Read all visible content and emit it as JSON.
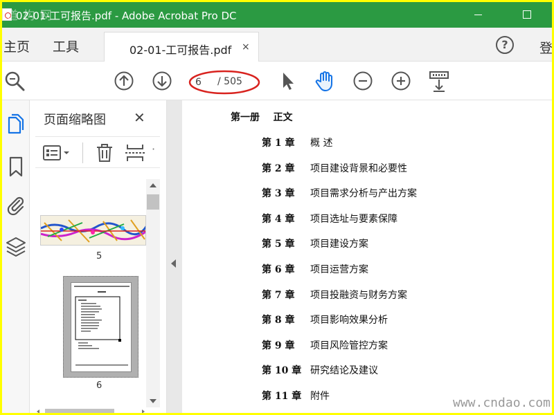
{
  "window": {
    "title": "02-01-工可报告.pdf - Adobe Acrobat Pro DC",
    "watermark_logo": "道·构·网"
  },
  "menubar": {
    "home": "主页",
    "tools": "工具",
    "tab_label": "02-01-工可报告.pdf",
    "tab_close": "×",
    "help": "?",
    "signin": "登"
  },
  "toolbar": {
    "current_page": "6",
    "total_pages": "/ 505",
    "icons": [
      "zoom-search-icon",
      "page-up-icon",
      "page-down-icon",
      "select-arrow-icon",
      "hand-tool-icon",
      "zoom-out-icon",
      "zoom-in-icon",
      "scroll-mode-icon"
    ],
    "highlight_color": "#d8221e"
  },
  "sidebar": {
    "rail_icons": [
      "page-thumbnails-icon",
      "bookmarks-icon",
      "attachments-icon",
      "layers-icon"
    ],
    "panel_title": "页面缩略图",
    "panel_close": "✕",
    "thumbnails": [
      {
        "label": "5"
      },
      {
        "label": "6"
      }
    ]
  },
  "document": {
    "heading": "第一册    正文",
    "chapters": [
      {
        "num": "第 1 章",
        "title": "概    述"
      },
      {
        "num": "第 2 章",
        "title": "项目建设背景和必要性"
      },
      {
        "num": "第 3 章",
        "title": "项目需求分析与产出方案"
      },
      {
        "num": "第 4 章",
        "title": "项目选址与要素保障"
      },
      {
        "num": "第 5 章",
        "title": "项目建设方案"
      },
      {
        "num": "第 6 章",
        "title": "项目运营方案"
      },
      {
        "num": "第 7 章",
        "title": "项目投融资与财务方案"
      },
      {
        "num": "第 8 章",
        "title": "项目影响效果分析"
      },
      {
        "num": "第 9 章",
        "title": "项目风险管控方案"
      },
      {
        "num": "第 10 章",
        "title": "研究结论及建议"
      },
      {
        "num": "第 11 章",
        "title": "附件"
      }
    ]
  },
  "footer_watermark": "www.cndao.com",
  "colors": {
    "titlebar": "#2b9a42",
    "frame": "#ffff00",
    "accent_blue": "#1473e6"
  }
}
